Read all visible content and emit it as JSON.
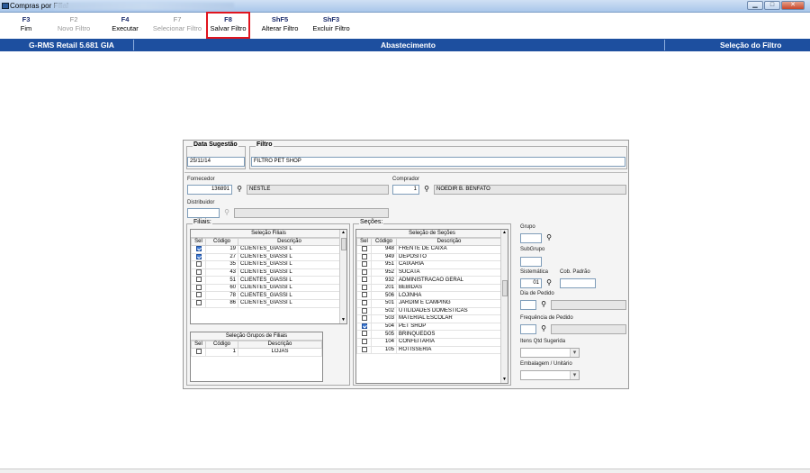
{
  "window": {
    "title": "Compras por Filial"
  },
  "toolbar": {
    "buttons": [
      {
        "key": "F3",
        "label": "Fim"
      },
      {
        "key": "F2",
        "label": "Novo Filtro"
      },
      {
        "key": "F4",
        "label": "Executar"
      },
      {
        "key": "F7",
        "label": "Selecionar Filtro"
      },
      {
        "key": "F8",
        "label": "Salvar Filtro"
      },
      {
        "key": "ShF5",
        "label": "Alterar Filtro"
      },
      {
        "key": "ShF3",
        "label": "Excluir Filtro"
      }
    ]
  },
  "header": {
    "left": "G-RMS Retail 5.681 GIA",
    "center": "Abastecimento",
    "right": "Seleção do Filtro"
  },
  "form": {
    "data_sugestao": {
      "label": "Data Sugestão",
      "value": "25/11/14"
    },
    "filtro": {
      "label": "Filtro",
      "value": "FILTRO PET SHOP"
    },
    "fornecedor": {
      "label": "Fornecedor",
      "code": "136891",
      "name": "NESTLE"
    },
    "comprador": {
      "label": "Comprador",
      "code": "1",
      "name": "NOEDIR B. BENFATO"
    },
    "distribuidor": {
      "label": "Distribuidor",
      "code": "",
      "name": ""
    },
    "filiais": {
      "label": "Filiais:",
      "grid_title": "Seleção Filiais",
      "columns": [
        "Sel",
        "Código",
        "Descrição"
      ],
      "rows": [
        {
          "sel": true,
          "code": "19",
          "desc": "CLIENTES_GIASSI L"
        },
        {
          "sel": true,
          "code": "27",
          "desc": "CLIENTES_GIASSI L"
        },
        {
          "sel": false,
          "code": "35",
          "desc": "CLIENTES_GIASSI L"
        },
        {
          "sel": false,
          "code": "43",
          "desc": "CLIENTES_GIASSI L"
        },
        {
          "sel": false,
          "code": "51",
          "desc": "CLIENTES_GIASSI L"
        },
        {
          "sel": false,
          "code": "60",
          "desc": "CLIENTES_GIASSI L"
        },
        {
          "sel": false,
          "code": "78",
          "desc": "CLIENTES_GIASSI L"
        },
        {
          "sel": false,
          "code": "86",
          "desc": "CLIENTES_GIASSI L"
        }
      ]
    },
    "grupos_filiais": {
      "grid_title": "Seleção Grupos de Filiais",
      "columns": [
        "Sel",
        "Código",
        "Descrição"
      ],
      "rows": [
        {
          "sel": false,
          "code": "1",
          "desc": "LOJAS"
        }
      ]
    },
    "secoes": {
      "label": "Seções:",
      "grid_title": "Seleção de Seções",
      "columns": [
        "Sel",
        "Código",
        "Descrição"
      ],
      "rows": [
        {
          "sel": false,
          "code": "948",
          "desc": "FRENTE DE CAIXA"
        },
        {
          "sel": false,
          "code": "949",
          "desc": "DEPOSITO"
        },
        {
          "sel": false,
          "code": "951",
          "desc": "CAIXARIA"
        },
        {
          "sel": false,
          "code": "952",
          "desc": "SUCATA"
        },
        {
          "sel": false,
          "code": "932",
          "desc": "ADMINISTRACAO GERAL"
        },
        {
          "sel": false,
          "code": "201",
          "desc": "BEBIDAS"
        },
        {
          "sel": false,
          "code": "506",
          "desc": "LOJINHA"
        },
        {
          "sel": false,
          "code": "501",
          "desc": "JARDIM E CAMPING"
        },
        {
          "sel": false,
          "code": "502",
          "desc": "UTILIDADES DOMESTICAS"
        },
        {
          "sel": false,
          "code": "503",
          "desc": "MATERIAL ESCOLAR"
        },
        {
          "sel": true,
          "code": "504",
          "desc": "PET SHOP"
        },
        {
          "sel": false,
          "code": "505",
          "desc": "BRINQUEDOS"
        },
        {
          "sel": false,
          "code": "104",
          "desc": "CONFEITARIA"
        },
        {
          "sel": false,
          "code": "105",
          "desc": "ROTISSERIA"
        }
      ]
    },
    "grupo": {
      "label": "Grupo"
    },
    "subgrupo": {
      "label": "SubGrupo"
    },
    "sistematica": {
      "label": "Sistemática",
      "value": "01"
    },
    "cob_padrao": {
      "label": "Cob. Padrão",
      "value": ""
    },
    "dia_pedido": {
      "label": "Dia de Pedido"
    },
    "freq_pedido": {
      "label": "Frequência de Pedido"
    },
    "itens_qtd": {
      "label": "Itens Qtd Sugerida"
    },
    "embalagem": {
      "label": "Embalagem / Unitário"
    }
  }
}
